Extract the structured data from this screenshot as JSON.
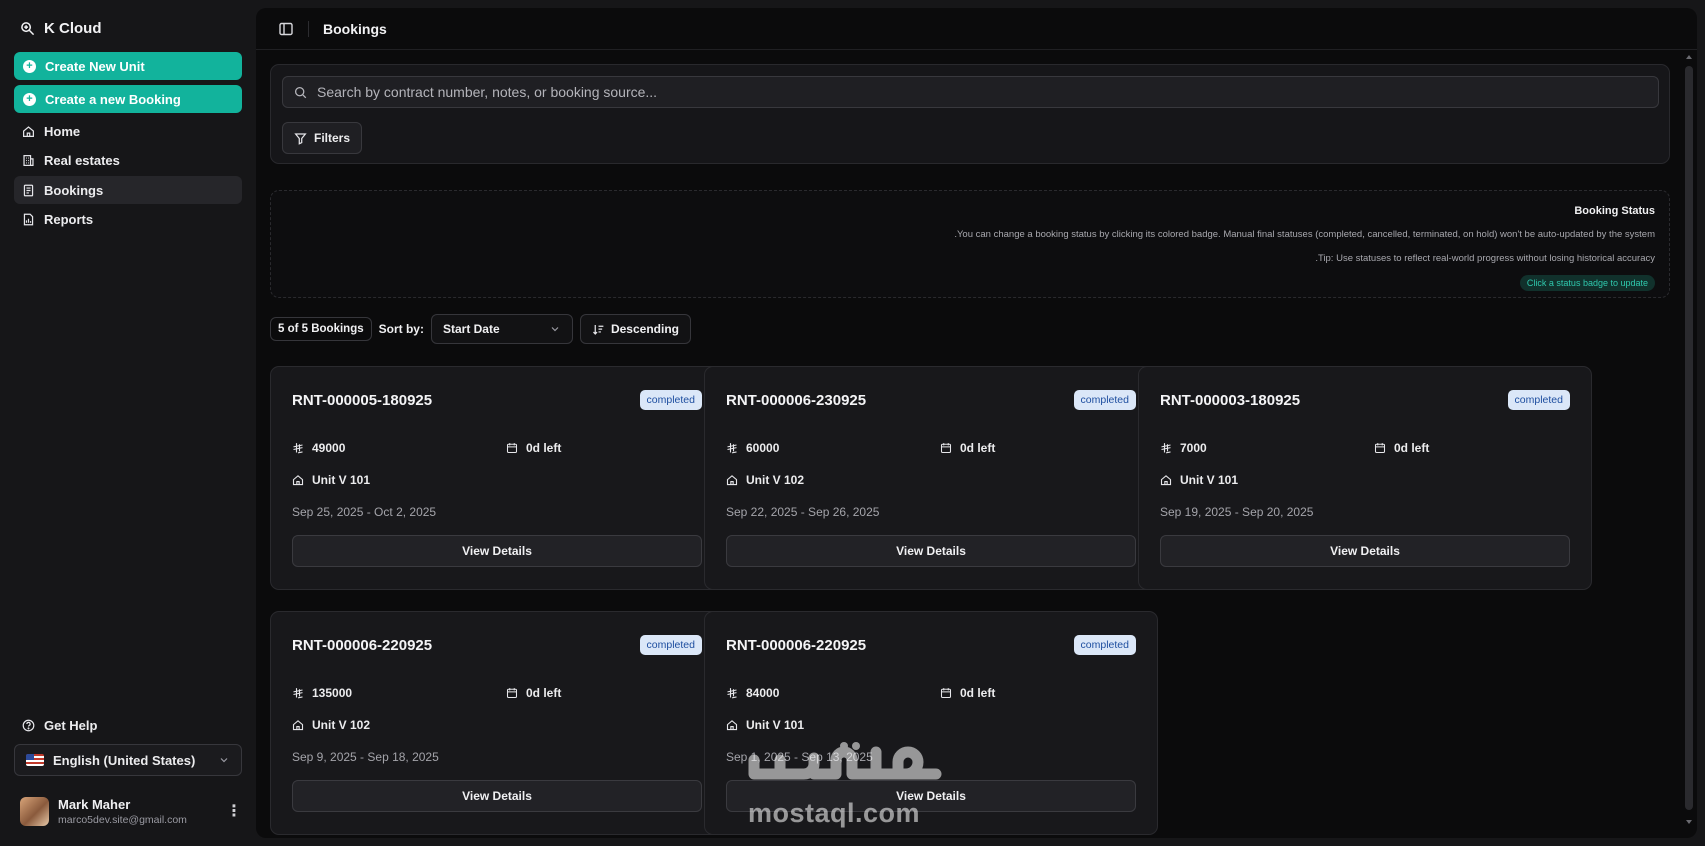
{
  "app": {
    "name": "K Cloud"
  },
  "sidebar": {
    "actions": [
      {
        "label": "Create New Unit"
      },
      {
        "label": "Create a new Booking"
      }
    ],
    "items": [
      {
        "label": "Home",
        "icon": "home-icon"
      },
      {
        "label": "Real estates",
        "icon": "building-icon"
      },
      {
        "label": "Bookings",
        "icon": "bookings-icon",
        "active": true
      },
      {
        "label": "Reports",
        "icon": "reports-icon"
      }
    ],
    "help_label": "Get Help",
    "language": "English (United States)",
    "user": {
      "name": "Mark Maher",
      "email": "marco5dev.site@gmail.com"
    }
  },
  "header": {
    "title": "Bookings"
  },
  "search": {
    "value": "",
    "placeholder": "Search by contract number, notes, or booking source...",
    "filters_label": "Filters"
  },
  "info": {
    "title": "Booking Status",
    "line1": ".You can change a booking status by clicking its colored badge. Manual final statuses (completed, cancelled, terminated, on hold) won't be auto-updated by the system",
    "line2": ".Tip: Use statuses to reflect real-world progress without losing historical accuracy",
    "badge": "Click a status badge to update"
  },
  "toolbar": {
    "count": "5 of 5 Bookings",
    "sort_label": "Sort by:",
    "sort_value": "Start Date",
    "order_label": "Descending"
  },
  "bookings": [
    {
      "contract": "RNT-000005-180925",
      "status": "completed",
      "price": "49000",
      "remaining": "0d left",
      "unit": "Unit V 101",
      "dates": "Sep 25, 2025 - Oct 2, 2025",
      "action": "View Details"
    },
    {
      "contract": "RNT-000006-230925",
      "status": "completed",
      "price": "60000",
      "remaining": "0d left",
      "unit": "Unit V 102",
      "dates": "Sep 22, 2025 - Sep 26, 2025",
      "action": "View Details"
    },
    {
      "contract": "RNT-000003-180925",
      "status": "completed",
      "price": "7000",
      "remaining": "0d left",
      "unit": "Unit V 101",
      "dates": "Sep 19, 2025 - Sep 20, 2025",
      "action": "View Details"
    },
    {
      "contract": "RNT-000006-220925",
      "status": "completed",
      "price": "135000",
      "remaining": "0d left",
      "unit": "Unit V 102",
      "dates": "Sep 9, 2025 - Sep 18, 2025",
      "action": "View Details"
    },
    {
      "contract": "RNT-000006-220925",
      "status": "completed",
      "price": "84000",
      "remaining": "0d left",
      "unit": "Unit V 101",
      "dates": "Sep 1, 2025 - Sep 13, 2025",
      "action": "View Details"
    }
  ],
  "watermark": {
    "arabic": "مستقل",
    "latin": "mostaql.com"
  },
  "colors": {
    "accent": "#12b39c",
    "badge_bg": "#dbe7f8",
    "badge_text": "#1f4fa0",
    "background": "#0b0b0c"
  }
}
